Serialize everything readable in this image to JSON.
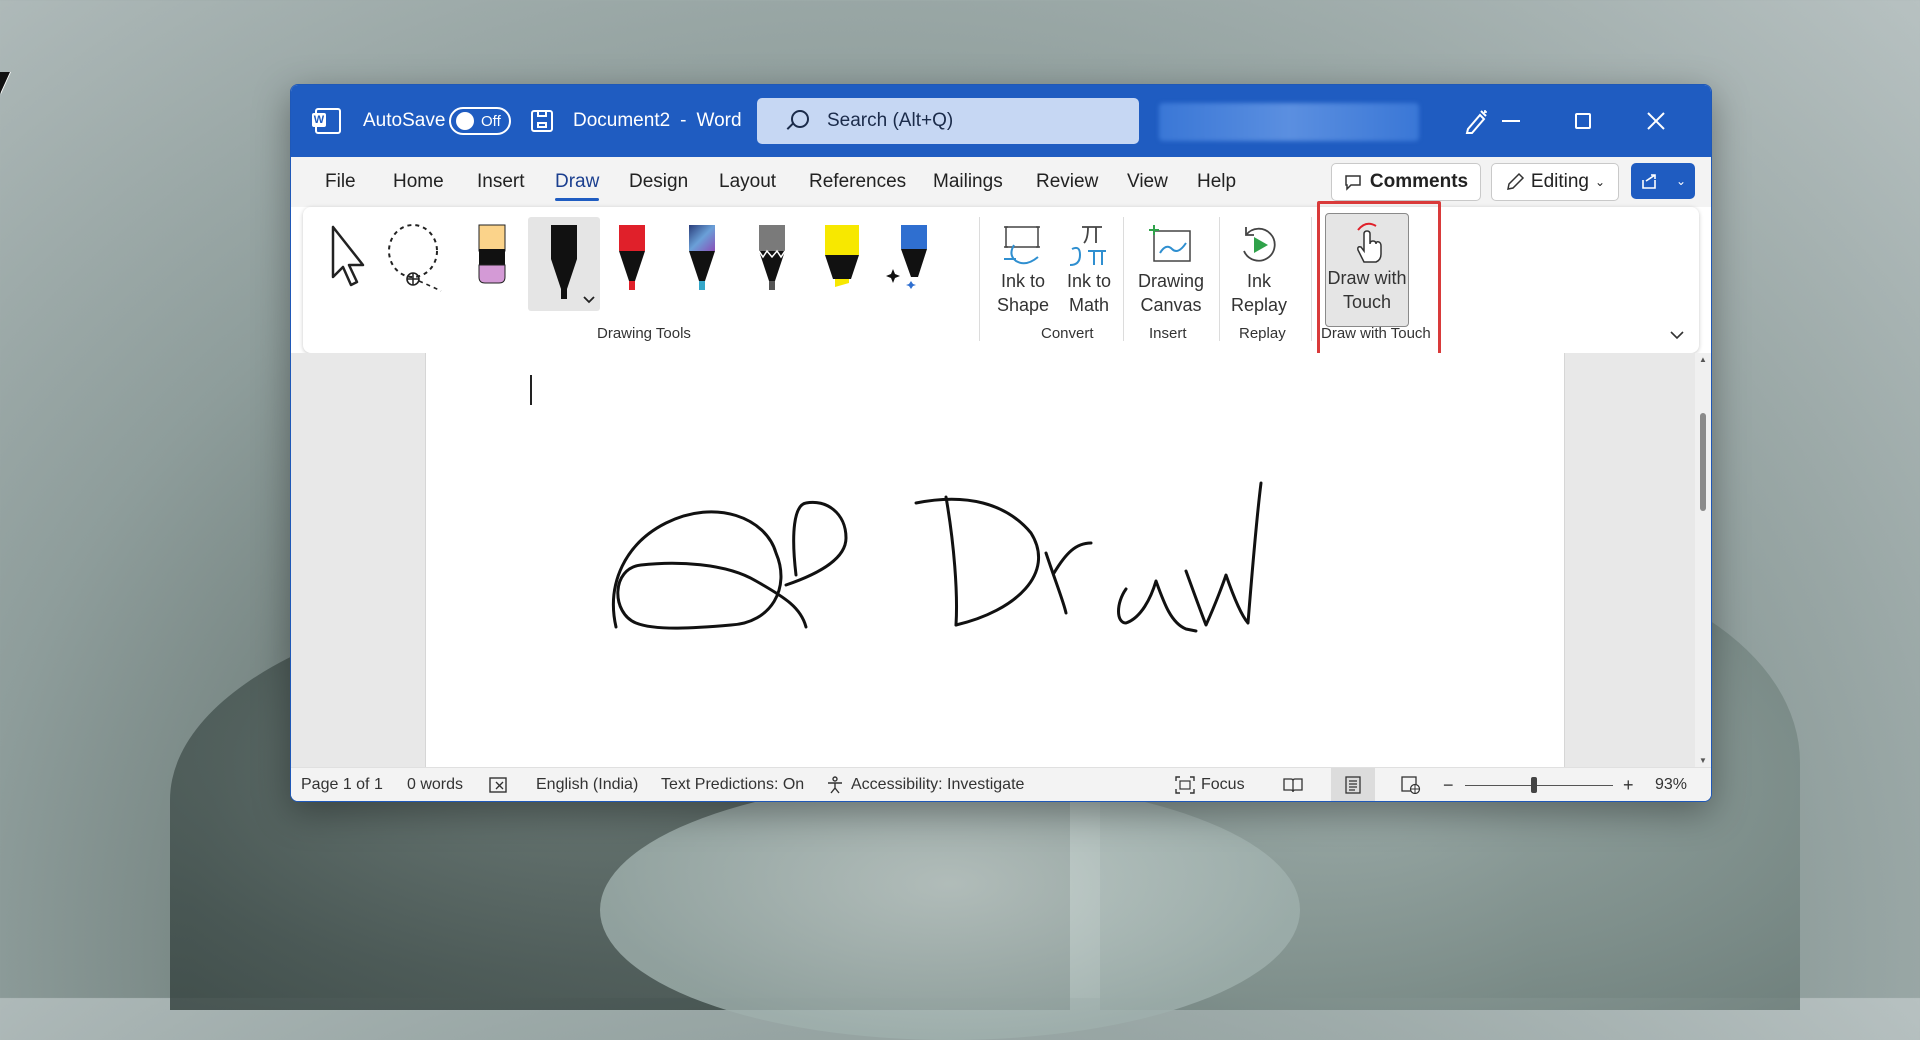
{
  "titlebar": {
    "autosave_label": "AutoSave",
    "autosave_state": "Off",
    "document_name": "Document2",
    "separator": "-",
    "app_name": "Word",
    "search_placeholder": "Search (Alt+Q)"
  },
  "menu": {
    "tabs": [
      "File",
      "Home",
      "Insert",
      "Draw",
      "Design",
      "Layout",
      "References",
      "Mailings",
      "Review",
      "View",
      "Help"
    ],
    "active_tab": "Draw",
    "comments_label": "Comments",
    "editing_label": "Editing"
  },
  "ribbon": {
    "groups": {
      "drawing_tools": "Drawing Tools",
      "convert": "Convert",
      "insert": "Insert",
      "replay": "Replay",
      "draw_with_touch": "Draw with Touch"
    },
    "buttons": {
      "ink_to_shape_1": "Ink to",
      "ink_to_shape_2": "Shape",
      "ink_to_math_1": "Ink to",
      "ink_to_math_2": "Math",
      "drawing_canvas_1": "Drawing",
      "drawing_canvas_2": "Canvas",
      "ink_replay_1": "Ink",
      "ink_replay_2": "Replay",
      "draw_with_touch_1": "Draw with",
      "draw_with_touch_2": "Touch"
    },
    "pens": [
      {
        "name": "black-pen",
        "color": "#111111"
      },
      {
        "name": "red-pen",
        "color": "#e0202a"
      },
      {
        "name": "galaxy-pen",
        "color": "#4a6fa0"
      },
      {
        "name": "pencil",
        "color": "#7a7a7a"
      },
      {
        "name": "yellow-highlighter",
        "color": "#f7e800"
      },
      {
        "name": "action-pen",
        "color": "#2f6fd0"
      }
    ],
    "accent_highlight": "#d93a3a"
  },
  "status": {
    "page": "Page 1 of 1",
    "words": "0 words",
    "language": "English (India)",
    "text_predictions": "Text Predictions: On",
    "accessibility": "Accessibility: Investigate",
    "focus": "Focus",
    "zoom": "93%"
  },
  "colors": {
    "titlebar": "#1f5cc1",
    "search_bg": "#c6d7f3"
  }
}
